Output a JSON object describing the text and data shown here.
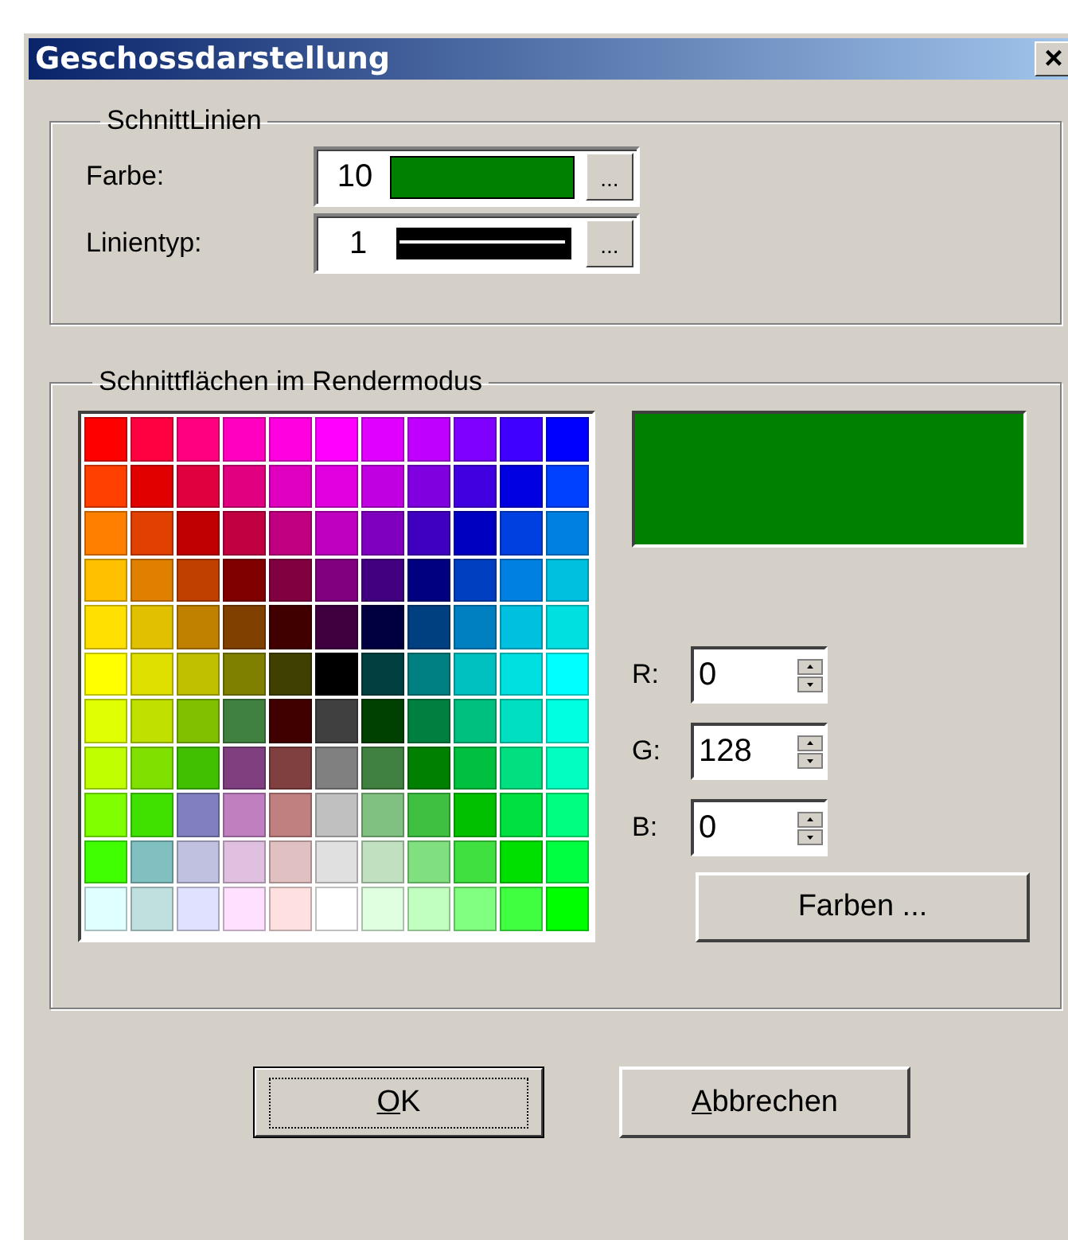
{
  "window": {
    "title": "Geschossdarstellung",
    "close": "×"
  },
  "schnittlinien": {
    "title": "SchnittLinien",
    "farbe": {
      "label": "Farbe:",
      "value": "10",
      "color": "#008000",
      "browse": "..."
    },
    "linientyp": {
      "label": "Linientyp:",
      "value": "1",
      "browse": "..."
    }
  },
  "schnittflaechen": {
    "title": "Schnittflächen im Rendermodus",
    "palette": [
      [
        {
          "color": "#ff0000",
          "selected": false
        },
        {
          "color": "#ff0040",
          "selected": false
        },
        {
          "color": "#ff0080",
          "selected": false
        },
        {
          "color": "#ff00c0",
          "selected": false
        },
        {
          "color": "#ff00e0",
          "selected": false
        },
        {
          "color": "#ff00ff",
          "selected": false
        },
        {
          "color": "#e000ff",
          "selected": false
        },
        {
          "color": "#c000ff",
          "selected": false
        },
        {
          "color": "#8000ff",
          "selected": false
        },
        {
          "color": "#4000ff",
          "selected": false
        },
        {
          "color": "#0000ff",
          "selected": false
        }
      ],
      [
        {
          "color": "#ff4000",
          "selected": false
        },
        {
          "color": "#e00000",
          "selected": false
        },
        {
          "color": "#e00040",
          "selected": false
        },
        {
          "color": "#e00080",
          "selected": false
        },
        {
          "color": "#e000c0",
          "selected": false
        },
        {
          "color": "#e000e0",
          "selected": false
        },
        {
          "color": "#c000e0",
          "selected": false
        },
        {
          "color": "#8000e0",
          "selected": false
        },
        {
          "color": "#4000e0",
          "selected": false
        },
        {
          "color": "#0000e0",
          "selected": false
        },
        {
          "color": "#0040ff",
          "selected": false
        }
      ],
      [
        {
          "color": "#ff8000",
          "selected": false
        },
        {
          "color": "#e04000",
          "selected": false
        },
        {
          "color": "#c00000",
          "selected": false
        },
        {
          "color": "#c00040",
          "selected": false
        },
        {
          "color": "#c00080",
          "selected": false
        },
        {
          "color": "#c000c0",
          "selected": false
        },
        {
          "color": "#8000c0",
          "selected": false
        },
        {
          "color": "#4000c0",
          "selected": false
        },
        {
          "color": "#0000c0",
          "selected": false
        },
        {
          "color": "#0040e0",
          "selected": false
        },
        {
          "color": "#0080e0",
          "selected": false
        }
      ],
      [
        {
          "color": "#ffc000",
          "selected": false
        },
        {
          "color": "#e08000",
          "selected": false
        },
        {
          "color": "#c04000",
          "selected": false
        },
        {
          "color": "#800000",
          "selected": false
        },
        {
          "color": "#800040",
          "selected": false
        },
        {
          "color": "#800080",
          "selected": false
        },
        {
          "color": "#400080",
          "selected": false
        },
        {
          "color": "#000080",
          "selected": false
        },
        {
          "color": "#0040c0",
          "selected": false
        },
        {
          "color": "#0080e0",
          "selected": false
        },
        {
          "color": "#00c0e0",
          "selected": false
        }
      ],
      [
        {
          "color": "#ffe000",
          "selected": false
        },
        {
          "color": "#e0c000",
          "selected": false
        },
        {
          "color": "#c08000",
          "selected": false
        },
        {
          "color": "#804000",
          "selected": false
        },
        {
          "color": "#400000",
          "selected": false
        },
        {
          "color": "#400040",
          "selected": false
        },
        {
          "color": "#000040",
          "selected": false
        },
        {
          "color": "#004080",
          "selected": false
        },
        {
          "color": "#0080c0",
          "selected": false
        },
        {
          "color": "#00c0e0",
          "selected": false
        },
        {
          "color": "#00e0e0",
          "selected": false
        }
      ],
      [
        {
          "color": "#ffff00",
          "selected": false
        },
        {
          "color": "#e0e000",
          "selected": false
        },
        {
          "color": "#c0c000",
          "selected": false
        },
        {
          "color": "#808000",
          "selected": false
        },
        {
          "color": "#404000",
          "selected": false
        },
        {
          "color": "#000000",
          "selected": false
        },
        {
          "color": "#004040",
          "selected": false
        },
        {
          "color": "#008080",
          "selected": false
        },
        {
          "color": "#00c0c0",
          "selected": false
        },
        {
          "color": "#00e0e0",
          "selected": false
        },
        {
          "color": "#00ffff",
          "selected": false
        }
      ],
      [
        {
          "color": "#e0ff00",
          "selected": false
        },
        {
          "color": "#c0e000",
          "selected": false
        },
        {
          "color": "#80c000",
          "selected": false
        },
        {
          "color": "#408040",
          "selected": false
        },
        {
          "color": "#400000",
          "selected": false
        },
        {
          "color": "#404040",
          "selected": false
        },
        {
          "color": "#004000",
          "selected": false
        },
        {
          "color": "#008040",
          "selected": false
        },
        {
          "color": "#00c080",
          "selected": false
        },
        {
          "color": "#00e0c0",
          "selected": false
        },
        {
          "color": "#00ffe0",
          "selected": false
        }
      ],
      [
        {
          "color": "#c0ff00",
          "selected": false
        },
        {
          "color": "#80e000",
          "selected": false
        },
        {
          "color": "#40c000",
          "selected": false
        },
        {
          "color": "#804080",
          "selected": false
        },
        {
          "color": "#804040",
          "selected": false
        },
        {
          "color": "#808080",
          "selected": false
        },
        {
          "color": "#408040",
          "selected": false
        },
        {
          "color": "#008000",
          "selected": false
        },
        {
          "color": "#00c040",
          "selected": false
        },
        {
          "color": "#00e080",
          "selected": false
        },
        {
          "color": "#00ffc0",
          "selected": false
        }
      ],
      [
        {
          "color": "#80ff00",
          "selected": false
        },
        {
          "color": "#40e000",
          "selected": false
        },
        {
          "color": "#8080c0",
          "selected": false
        },
        {
          "color": "#c080c0",
          "selected": false
        },
        {
          "color": "#c08080",
          "selected": false
        },
        {
          "color": "#c0c0c0",
          "selected": false
        },
        {
          "color": "#80c080",
          "selected": false
        },
        {
          "color": "#40c040",
          "selected": false
        },
        {
          "color": "#00c000",
          "selected": false
        },
        {
          "color": "#00e040",
          "selected": false
        },
        {
          "color": "#00ff80",
          "selected": false
        }
      ],
      [
        {
          "color": "#40ff00",
          "selected": false
        },
        {
          "color": "#80c0c0",
          "selected": false
        },
        {
          "color": "#c0c0e0",
          "selected": false
        },
        {
          "color": "#e0c0e0",
          "selected": false
        },
        {
          "color": "#e0c0c0",
          "selected": false
        },
        {
          "color": "#e0e0e0",
          "selected": false
        },
        {
          "color": "#c0e0c0",
          "selected": false
        },
        {
          "color": "#80e080",
          "selected": false
        },
        {
          "color": "#40e040",
          "selected": false
        },
        {
          "color": "#00e000",
          "selected": false
        },
        {
          "color": "#00ff40",
          "selected": false
        }
      ],
      [
        {
          "color": "#e0ffff",
          "selected": false
        },
        {
          "color": "#c0e0e0",
          "selected": false
        },
        {
          "color": "#e0e0ff",
          "selected": false
        },
        {
          "color": "#ffe0ff",
          "selected": false
        },
        {
          "color": "#ffe0e0",
          "selected": false
        },
        {
          "color": "#ffffff",
          "selected": false
        },
        {
          "color": "#e0ffe0",
          "selected": false
        },
        {
          "color": "#c0ffc0",
          "selected": false
        },
        {
          "color": "#80ff80",
          "selected": false
        },
        {
          "color": "#40ff40",
          "selected": false
        },
        {
          "color": "#00ff00",
          "selected": false
        }
      ]
    ],
    "preview": {
      "color": "#008000"
    },
    "channels": [
      {
        "label": "R:",
        "value": "0"
      },
      {
        "label": "G:",
        "value": "128"
      },
      {
        "label": "B:",
        "value": "0"
      }
    ],
    "colors_button": "Farben ..."
  },
  "buttons": [
    {
      "label": "OK",
      "default": true
    },
    {
      "label": "Abbrechen",
      "default": false
    }
  ]
}
